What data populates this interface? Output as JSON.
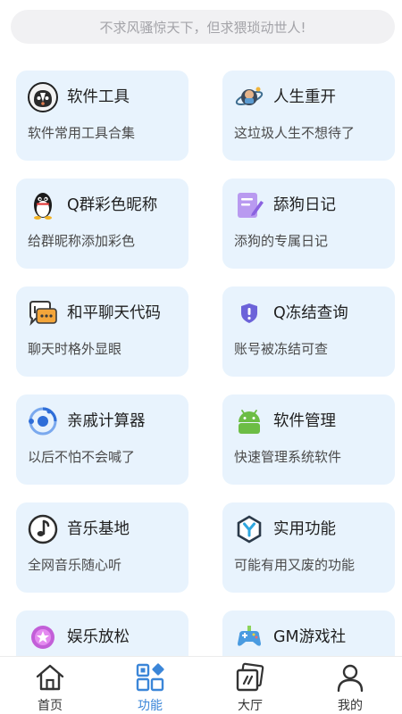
{
  "header": {
    "slogan": "不求风骚惊天下，但求猥琐动世人!"
  },
  "cards": [
    {
      "title": "软件工具",
      "desc": "软件常用工具合集",
      "icon": "badger-avatar-icon"
    },
    {
      "title": "人生重开",
      "desc": "这垃圾人生不想待了",
      "icon": "astronaut-planet-icon"
    },
    {
      "title": "Q群彩色昵称",
      "desc": "给群昵称添加彩色",
      "icon": "penguin-icon"
    },
    {
      "title": "舔狗日记",
      "desc": "添狗的专属日记",
      "icon": "notebook-pen-icon"
    },
    {
      "title": "和平聊天代码",
      "desc": "聊天时格外显眼",
      "icon": "chat-bubbles-icon"
    },
    {
      "title": "Q冻结查询",
      "desc": "账号被冻结可查",
      "icon": "shield-icon"
    },
    {
      "title": "亲戚计算器",
      "desc": "以后不怕不会喊了",
      "icon": "orbit-circle-icon"
    },
    {
      "title": "软件管理",
      "desc": "快速管理系统软件",
      "icon": "android-icon"
    },
    {
      "title": "音乐基地",
      "desc": "全网音乐随心听",
      "icon": "music-note-icon"
    },
    {
      "title": "实用功能",
      "desc": "可能有用又废的功能",
      "icon": "hexagon-y-icon"
    },
    {
      "title": "娱乐放松",
      "desc": "",
      "icon": "star-badge-icon"
    },
    {
      "title": "GM游戏社",
      "desc": "",
      "icon": "gamepad-icon"
    }
  ],
  "tabs": [
    {
      "label": "首页",
      "icon": "home-icon",
      "active": false
    },
    {
      "label": "功能",
      "icon": "apps-grid-icon",
      "active": true
    },
    {
      "label": "大厅",
      "icon": "cards-icon",
      "active": false
    },
    {
      "label": "我的",
      "icon": "user-icon",
      "active": false
    }
  ],
  "colors": {
    "accent": "#3b86d8",
    "card_bg": "#e8f3fd"
  }
}
